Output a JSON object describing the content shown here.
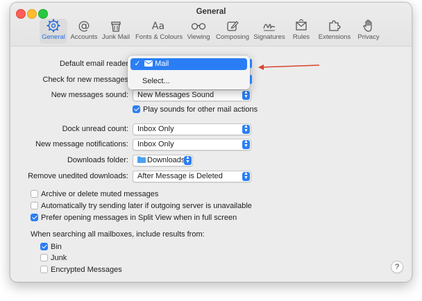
{
  "window": {
    "title": "General"
  },
  "toolbar": {
    "tabs": [
      {
        "label": "General",
        "icon": "gear-icon",
        "active": true
      },
      {
        "label": "Accounts",
        "icon": "at-icon"
      },
      {
        "label": "Junk Mail",
        "icon": "trash-icon"
      },
      {
        "label": "Fonts & Colours",
        "icon": "font-icon"
      },
      {
        "label": "Viewing",
        "icon": "glasses-icon"
      },
      {
        "label": "Composing",
        "icon": "pencil-square-icon"
      },
      {
        "label": "Signatures",
        "icon": "signature-icon"
      },
      {
        "label": "Rules",
        "icon": "envelope-rules-icon"
      },
      {
        "label": "Extensions",
        "icon": "puzzle-icon"
      },
      {
        "label": "Privacy",
        "icon": "hand-icon"
      }
    ],
    "font_glyph": "Aa"
  },
  "settings": {
    "default_email_reader": {
      "label": "Default email reader"
    },
    "check_new_messages": {
      "label": "Check for new messages"
    },
    "new_messages_sound": {
      "label": "New messages sound:",
      "value": "New Messages Sound"
    },
    "play_sounds": {
      "label": "Play sounds for other mail actions",
      "checked": true
    },
    "dock_unread_count": {
      "label": "Dock unread count:",
      "value": "Inbox Only"
    },
    "new_message_notifications": {
      "label": "New message notifications:",
      "value": "Inbox Only"
    },
    "downloads_folder": {
      "label": "Downloads folder:",
      "value": "Downloads"
    },
    "remove_unedited_downloads": {
      "label": "Remove unedited downloads:",
      "value": "After Message is Deleted"
    },
    "archive_muted": {
      "label": "Archive or delete muted messages",
      "checked": false
    },
    "auto_send_later": {
      "label": "Automatically try sending later if outgoing server is unavailable",
      "checked": false
    },
    "prefer_split_view": {
      "label": "Prefer opening messages in Split View when in full screen",
      "checked": true
    },
    "search_mailboxes_heading": "When searching all mailboxes, include results from:",
    "search_bin": {
      "label": "Bin",
      "checked": true
    },
    "search_junk": {
      "label": "Junk",
      "checked": false
    },
    "search_encrypted": {
      "label": "Encrypted Messages",
      "checked": false
    }
  },
  "dropdown_menu": {
    "selected_item": {
      "label": "Mail",
      "check": "✓"
    },
    "other_item": {
      "label": "Select..."
    }
  },
  "help": {
    "label": "?"
  },
  "colors": {
    "accent": "#2a7ef5",
    "annotation_arrow": "#d9432f"
  }
}
